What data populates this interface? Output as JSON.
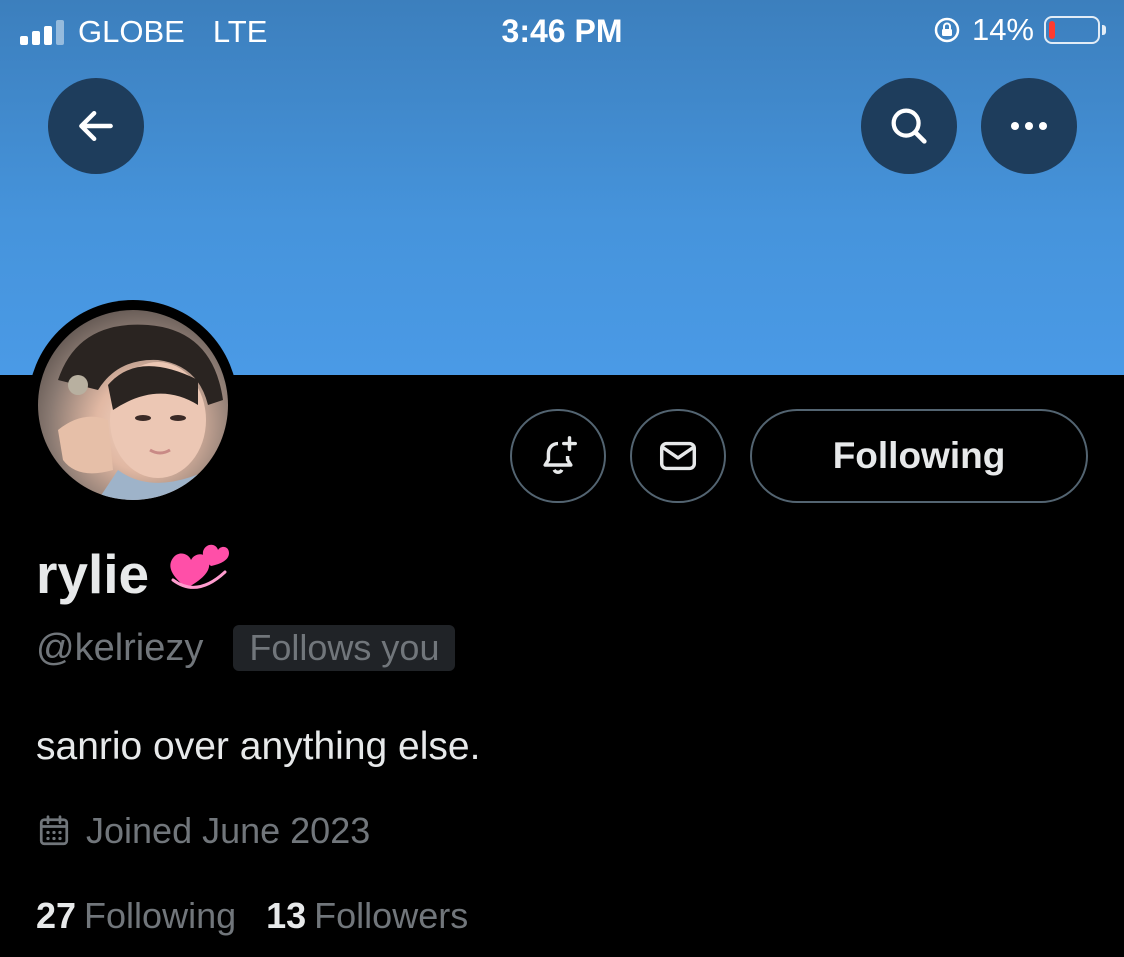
{
  "status_bar": {
    "carrier": "GLOBE",
    "network": "LTE",
    "time": "3:46 PM",
    "battery_percent": "14%",
    "battery_level": 0.14
  },
  "header": {
    "back_icon": "arrow-left-icon",
    "search_icon": "search-icon",
    "more_icon": "more-horizontal-icon"
  },
  "profile": {
    "display_name": "rylie",
    "name_emoji": "💞",
    "handle": "@kelriezy",
    "follows_you_label": "Follows you",
    "bio": "sanrio over anything else.",
    "joined": "Joined June 2023",
    "following_count": "27",
    "following_label": "Following",
    "followers_count": "13",
    "followers_label": "Followers"
  },
  "actions": {
    "notify_icon": "bell-plus-icon",
    "message_icon": "mail-icon",
    "following_button": "Following"
  },
  "colors": {
    "banner_top": "#3c7fbd",
    "banner_bottom": "#4a9ae6",
    "background": "#000000",
    "muted_text": "#71767b",
    "battery_low": "#ff3b30"
  }
}
